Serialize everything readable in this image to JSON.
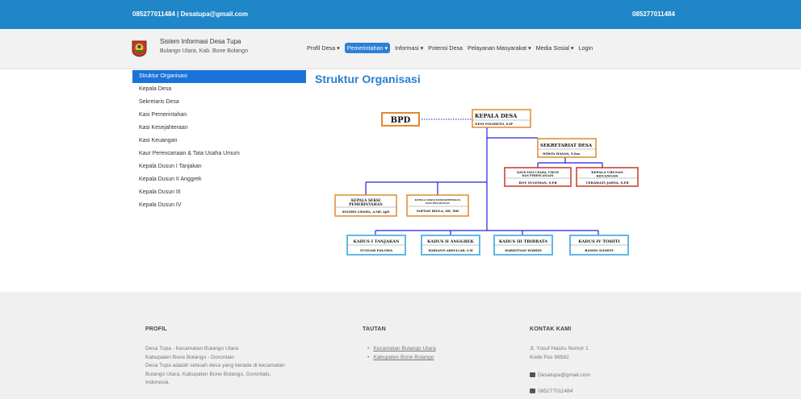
{
  "topbar": {
    "left_text": "085277011484 | Desatupa@gmail.com",
    "right_text": "085277011484"
  },
  "brand": {
    "title": "Sistem Informasi Desa Tupa",
    "subtitle": "Bulango Utara, Kab. Bone Bolango"
  },
  "menu": [
    {
      "label": "Profil Desa ▾"
    },
    {
      "label": "Pemerintahan ▾",
      "active": true
    },
    {
      "label": "Informasi ▾"
    },
    {
      "label": "Potensi Desa"
    },
    {
      "label": "Pelayanan Masyarakat ▾"
    },
    {
      "label": "Media Sosial ▾"
    },
    {
      "label": "Login"
    }
  ],
  "sidebar": {
    "items": [
      {
        "label": "Struktur Organisasi"
      },
      {
        "label": "Kepala Desa"
      },
      {
        "label": "Sekretaris Desa"
      },
      {
        "label": "Kasi Pemerintahan"
      },
      {
        "label": "Kasi Kesejahteraan"
      },
      {
        "label": "Kasi Keuangan"
      },
      {
        "label": "Kaur Perencanaan & Tata Usaha Umum"
      },
      {
        "label": "Kepala Dusun I Tanjakan"
      },
      {
        "label": "Kepala Dusun II Anggrek"
      },
      {
        "label": "Kepala Dusun III"
      },
      {
        "label": "Kepala Dusun IV"
      }
    ]
  },
  "main": {
    "title": "Struktur Organisasi"
  },
  "org": {
    "bpd": "BPD",
    "kades": {
      "title": "KEPALA DESA",
      "name": "NENI POLIHETO, S.IP"
    },
    "sekdes": {
      "title": "SEKRETARIAT DESA",
      "name": "WIWIN HASAN, S.Sos"
    },
    "kaur_tu": {
      "title1": "KAUR TATA USAHA, UMUM",
      "title2": "DAN PERENCANAAN",
      "name": "ROY SULEMAN, S.Pd"
    },
    "kaur_keu": {
      "title1": "KEPALA URUSAN",
      "title2": "KEUANGAN",
      "name": "VERAWATI JAHYA, S.Pd"
    },
    "kasi_pem": {
      "title1": "KEPALA SEKSI",
      "title2": "PEMERINTAHAN",
      "name": "SOLIHIN LIDAWA, A.Md, ApD"
    },
    "kasi_kes": {
      "title1": "KEPALA SEKSI KESEJAHTERAAN",
      "title2": "DAN PELAYANAN",
      "name": "SOFYAN BIOLA, SH, MH"
    },
    "dusun": [
      {
        "title": "KADUS I TANJAKAN",
        "name": "YUSNAR PALOWA"
      },
      {
        "title": "KADUS II ANGGREK",
        "name": "HARYANTI ABDULLAH, S.M"
      },
      {
        "title": "KADUS III TRIBRATA",
        "name": "HARKITNAS WAHIDI"
      },
      {
        "title": "KADUS IV TOHITI",
        "name": "RAMIN DAMITI"
      }
    ]
  },
  "footer": {
    "profil": {
      "heading": "PROFIL",
      "lines": [
        "Desa Tupa - Kecamatan Bulango Utara",
        "Kabupaten Bone Bolango - Gorontalo",
        "Desa Tupa adalah sebuah desa yang berada di kecamatan",
        "Bulango Utara, Kabupaten Bone Bolango, Gorontalo,",
        "Indonesia."
      ]
    },
    "tautan": {
      "heading": "TAUTAN",
      "links": [
        "Kecamatan Bulango Utara",
        "Kabupaten Bone Bolango"
      ]
    },
    "kontak": {
      "heading": "KONTAK KAMI",
      "address1": "Jl. Yusuf Hasiru Nomor 1",
      "address2": "Kode Pos 96582",
      "email": "Desatupa@gmail.com",
      "phone": "085277011484"
    }
  }
}
